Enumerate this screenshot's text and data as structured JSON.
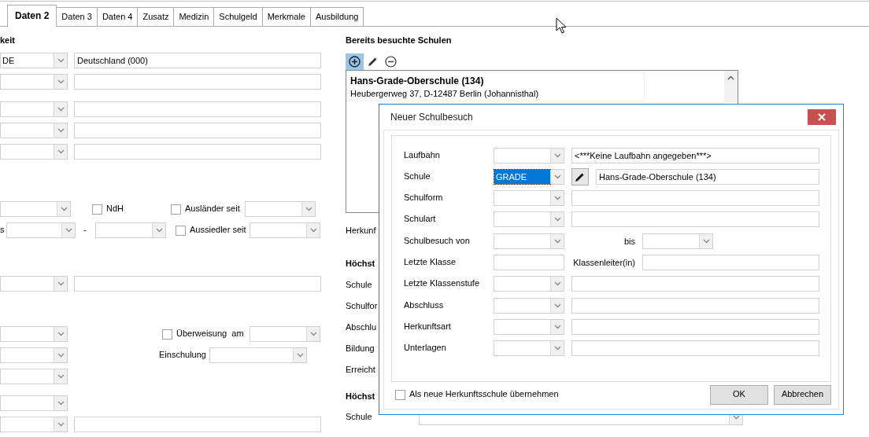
{
  "tabs": [
    {
      "label": "Daten 2",
      "selected": true
    },
    {
      "label": "Daten 3",
      "selected": false
    },
    {
      "label": "Daten 4",
      "selected": false
    },
    {
      "label": "Zusatz",
      "selected": false
    },
    {
      "label": "Medizin",
      "selected": false
    },
    {
      "label": "Schulgeld",
      "selected": false
    },
    {
      "label": "Merkmale",
      "selected": false
    },
    {
      "label": "Ausbildung",
      "selected": false
    }
  ],
  "left": {
    "heading": "keit",
    "rows": [
      {
        "items": [
          {
            "kind": "combo",
            "value": "DE"
          },
          {
            "kind": "field",
            "value": "Deutschland (000)"
          }
        ]
      },
      {
        "items": [
          {
            "kind": "combo"
          },
          {
            "kind": "field"
          }
        ]
      },
      {
        "items": [
          {
            "kind": "combo"
          },
          {
            "kind": "field"
          }
        ]
      },
      {
        "items": [
          {
            "kind": "combo"
          },
          {
            "kind": "field"
          }
        ]
      },
      {
        "items": [
          {
            "kind": "combo"
          },
          {
            "kind": "field"
          }
        ]
      },
      {
        "items": [
          {
            "kind": "combo"
          },
          {
            "kind": "checkbox",
            "label": "NdH",
            "checked": false
          },
          {
            "kind": "checkbox",
            "label": "Ausländer seit",
            "checked": false
          },
          {
            "kind": "combo"
          }
        ]
      },
      {
        "items": [
          {
            "kind": "label",
            "text": "s"
          },
          {
            "kind": "combo"
          },
          {
            "kind": "label",
            "text": "-"
          },
          {
            "kind": "combo"
          },
          {
            "kind": "checkbox",
            "label": "Aussiedler seit",
            "checked": false
          },
          {
            "kind": "combo"
          }
        ]
      },
      {
        "items": [
          {
            "kind": "combo"
          },
          {
            "kind": "field"
          }
        ]
      },
      {
        "items": [
          {
            "kind": "combo"
          },
          {
            "kind": "checkbox",
            "label": "Überweisung  am",
            "checked": false
          },
          {
            "kind": "combo"
          }
        ]
      },
      {
        "items": [
          {
            "kind": "combo"
          },
          {
            "kind": "label",
            "text": "Einschulung"
          },
          {
            "kind": "combo"
          }
        ]
      },
      {
        "items": [
          {
            "kind": "combo"
          }
        ]
      },
      {
        "items": [
          {
            "kind": "combo"
          }
        ]
      },
      {
        "items": [
          {
            "kind": "combo"
          },
          {
            "kind": "field"
          }
        ]
      }
    ]
  },
  "right": {
    "heading": "Bereits besuchte Schulen",
    "toolbar": [
      {
        "kind": "add",
        "active": true
      },
      {
        "kind": "edit",
        "active": false
      },
      {
        "kind": "remove",
        "active": false
      }
    ],
    "schools": [
      {
        "name": "Hans-Grade-Oberschule (134)",
        "address": "Heubergerweg 37, D-12487 Berlin (Johannisthal)"
      }
    ],
    "rows": [
      {
        "kind": "label",
        "text": "Herkunf"
      },
      {
        "kind": "heading",
        "text": "Höchst"
      },
      {
        "kind": "label",
        "text": "Schule"
      },
      {
        "kind": "label",
        "text": "Schulfor"
      },
      {
        "kind": "label",
        "text": "Abschlu"
      },
      {
        "kind": "label",
        "text": "Bildung"
      },
      {
        "kind": "label",
        "text": "Erreicht"
      },
      {
        "kind": "heading",
        "text": "Höchst"
      },
      {
        "kind": "label",
        "text": "Schule",
        "combo": true
      }
    ]
  },
  "dialog": {
    "title": "Neuer Schulbesuch",
    "groups": [
      [
        {
          "label": "Laufbahn",
          "items": [
            {
              "kind": "combo",
              "focused": false
            },
            {
              "kind": "field",
              "value": "<***Keine Laufbahn angegeben***>"
            }
          ]
        },
        {
          "label": "Schule",
          "items": [
            {
              "kind": "combo",
              "value": "GRADE",
              "focused": true
            },
            {
              "kind": "edit_button"
            },
            {
              "kind": "field",
              "value": "Hans-Grade-Oberschule (134)"
            }
          ]
        },
        {
          "label": "Schulform",
          "items": [
            {
              "kind": "combo",
              "focused": false
            },
            {
              "kind": "field"
            }
          ]
        },
        {
          "label": "Schulart",
          "items": [
            {
              "kind": "combo",
              "focused": false
            },
            {
              "kind": "field"
            }
          ]
        }
      ],
      [
        {
          "label": "Schulbesuch von",
          "items": [
            {
              "kind": "combo",
              "focused": false
            },
            {
              "kind": "label",
              "text": "bis"
            },
            {
              "kind": "combo",
              "focused": false
            }
          ]
        },
        {
          "label": "Letzte Klasse",
          "items": [
            {
              "kind": "field"
            },
            {
              "kind": "label",
              "text": "Klassenleiter(in)"
            },
            {
              "kind": "field"
            }
          ]
        },
        {
          "label": "Letzte Klassenstufe",
          "items": [
            {
              "kind": "combo",
              "focused": false
            },
            {
              "kind": "field"
            }
          ]
        }
      ],
      [
        {
          "label": "Abschluss",
          "items": [
            {
              "kind": "combo",
              "focused": false
            },
            {
              "kind": "field"
            }
          ]
        },
        {
          "label": "Herkunftsart",
          "items": [
            {
              "kind": "combo",
              "focused": false
            },
            {
              "kind": "field"
            }
          ]
        },
        {
          "label": "Unterlagen",
          "items": [
            {
              "kind": "combo",
              "focused": false
            },
            {
              "kind": "field"
            }
          ]
        }
      ]
    ],
    "checkbox": {
      "label": "Als neue Herkunftsschule übernehmen",
      "checked": false
    },
    "buttons": [
      "OK",
      "Abbrechen"
    ]
  }
}
